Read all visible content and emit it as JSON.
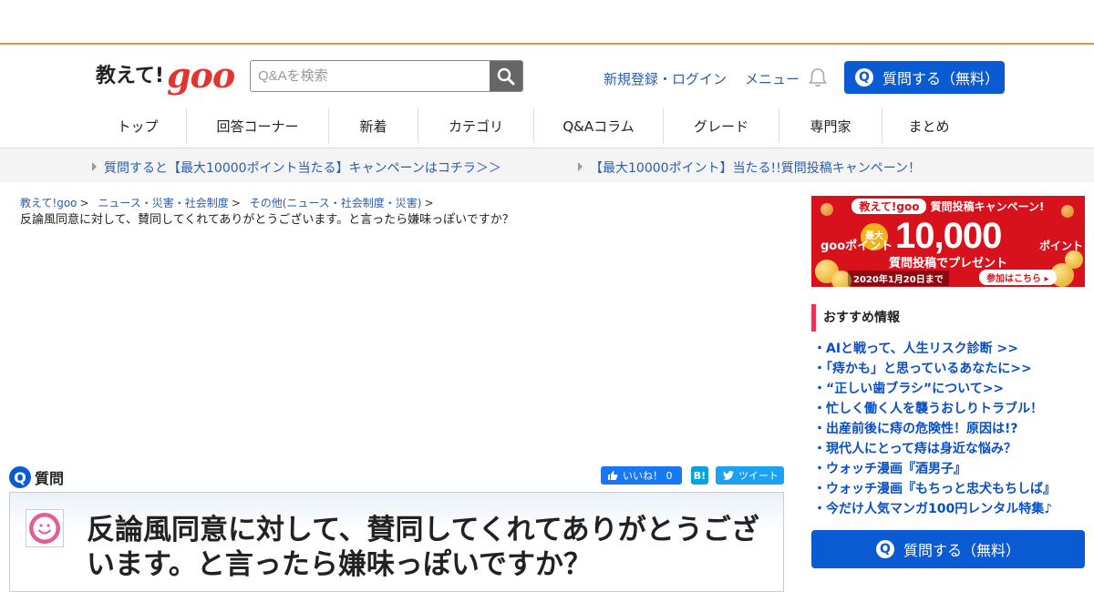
{
  "header": {
    "logo_text": "教えて!",
    "logo_brand": "goo",
    "search_placeholder": "Q&Aを検索",
    "login_link": "新規登録・ログイン",
    "menu_link": "メニュー",
    "ask_button": "質問する（無料）",
    "ask_icon": "Q"
  },
  "nav": {
    "items": [
      "トップ",
      "回答コーナー",
      "新着",
      "カテゴリ",
      "Q&Aコラム",
      "グレード",
      "専門家",
      "まとめ"
    ]
  },
  "campaigns": {
    "left": "質問すると【最大10000ポイント当たる】キャンペーンはコチラ＞＞",
    "right": "【最大10000ポイント】当たる!!質問投稿キャンペーン！"
  },
  "breadcrumb": {
    "items": [
      "教えて!goo",
      "ニュース・災害・社会制度",
      "その他(ニュース・社会制度・災害)"
    ],
    "separator": ">",
    "current": "反論風同意に対して、賛同してくれてありがとうございます。と言ったら嫌味っぽいですか？"
  },
  "question": {
    "section_label": "質問",
    "section_icon": "Q",
    "title": "反論風同意に対して、賛同してくれてありがとうございます。と言ったら嫌味っぽいですか？"
  },
  "social": {
    "like_label": "いいね！ 0",
    "hatena_label": "B!",
    "tweet_label": "ツイート"
  },
  "banner": {
    "top_text_1": "教えて!",
    "top_brand": "goo",
    "top_text_2": "質問投稿キャンペーン!",
    "max_label": "最大",
    "goo_points_label": "gooポイント",
    "amount": "10,000",
    "points_label": "ポイント",
    "present_text": "質問投稿でプレゼント",
    "deadline": "2020年1月20日まで",
    "join_label": "参加はこちら ▸"
  },
  "recommend": {
    "heading": "おすすめ情報",
    "items": [
      "・AIと戦って、人生リスク診断 >>",
      "・「痔かも」と思っているあなたに>>",
      "・“正しい歯ブラシ”について>>",
      "・忙しく働く人を襲うおしりトラブル！",
      "・出産前後に痔の危険性！原因は!?",
      "・現代人にとって痔は身近な悩み？",
      "・ウォッチ漫画『酒男子』",
      "・ウォッチ漫画『もちっと忠犬もちしば』",
      "・今だけ人気マンガ100円レンタル特集♪"
    ]
  },
  "sidebar_ask_button": "質問する（無料）",
  "colors": {
    "accent_orange": "#f08a4b",
    "brand_blue": "#0a5bd1",
    "link_blue": "#2a5db0",
    "banner_red": "#d8121c",
    "rec_bar": "#e8325a"
  }
}
